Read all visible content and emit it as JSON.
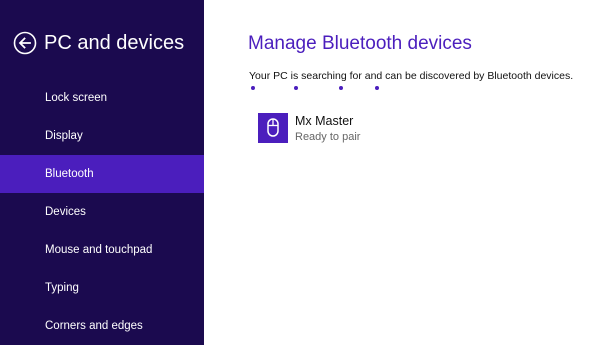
{
  "sidebar": {
    "title": "PC and devices",
    "back_icon": "back-arrow-icon",
    "items": [
      {
        "label": "Lock screen",
        "selected": false
      },
      {
        "label": "Display",
        "selected": false
      },
      {
        "label": "Bluetooth",
        "selected": true
      },
      {
        "label": "Devices",
        "selected": false
      },
      {
        "label": "Mouse and touchpad",
        "selected": false
      },
      {
        "label": "Typing",
        "selected": false
      },
      {
        "label": "Corners and edges",
        "selected": false
      }
    ]
  },
  "main": {
    "title": "Manage Bluetooth devices",
    "status": "Your PC is searching for and can be discovered by Bluetooth devices.",
    "devices": [
      {
        "name": "Mx Master",
        "status": "Ready to pair",
        "icon": "mouse-icon"
      }
    ]
  },
  "colors": {
    "sidebar_background": "#1b0a4f",
    "accent": "#4b1ebd",
    "text": "#111111",
    "secondary_text": "#666666"
  }
}
